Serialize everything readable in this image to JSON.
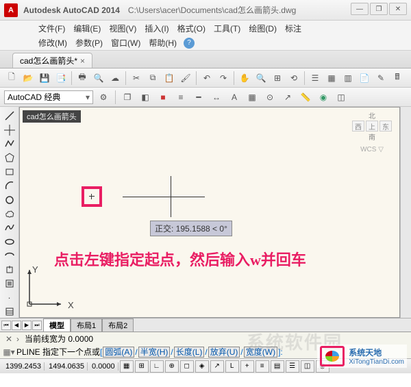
{
  "titlebar": {
    "app_initial": "A",
    "app_name": "Autodesk AutoCAD 2014",
    "file_path": "C:\\Users\\acer\\Documents\\cad怎么画箭头.dwg"
  },
  "win": {
    "min": "—",
    "max": "□",
    "close": "✕",
    "aux1": "—",
    "aux2": "❐",
    "aux3": "✕"
  },
  "menu1": {
    "file": "文件(F)",
    "edit": "编辑(E)",
    "view": "视图(V)",
    "insert": "插入(I)",
    "format": "格式(O)",
    "tools": "工具(T)",
    "draw": "绘图(D)",
    "annotate": "标注"
  },
  "menu2": {
    "modify": "修改(M)",
    "param": "参数(P)",
    "window": "窗口(W)",
    "help": "帮助(H)",
    "help_icon": "?"
  },
  "doc_tab": {
    "label": "cad怎么画箭头*",
    "close": "×"
  },
  "workspace": {
    "label": "AutoCAD 经典"
  },
  "canvas": {
    "doc_title": "cad怎么画箭头",
    "viewcube": {
      "n": "北",
      "w": "西",
      "top": "上",
      "e": "东",
      "s": "南",
      "wcs": "WCS ▽"
    },
    "tooltip": "正交: 195.1588 < 0°",
    "instruction": "点击左键指定起点，然后输入w并回车",
    "ucs_x": "X",
    "ucs_y": "Y"
  },
  "sheet_tabs": {
    "nav": {
      "first": "⏮",
      "prev": "◀",
      "next": "▶",
      "last": "⏭"
    },
    "model": "模型",
    "layout1": "布局1",
    "layout2": "布局2"
  },
  "cmd": {
    "line_width": "当前线宽为  0.0000",
    "prompt_prefix": "PLINE 指定下一个点或 ",
    "opt_arc": "圆弧(A)",
    "opt_half": "半宽(H)",
    "opt_len": "长度(L)",
    "opt_undo": "放弃(U)",
    "opt_width": "宽度(W)",
    "cursor": "▏"
  },
  "status": {
    "coord1": "1399.2453",
    "coord2": "1494.0635",
    "coord3": "0.0000"
  },
  "watermark": {
    "ghost": "系统软件园",
    "cn": "系统天地",
    "url": "XiTongTianDi.com"
  }
}
